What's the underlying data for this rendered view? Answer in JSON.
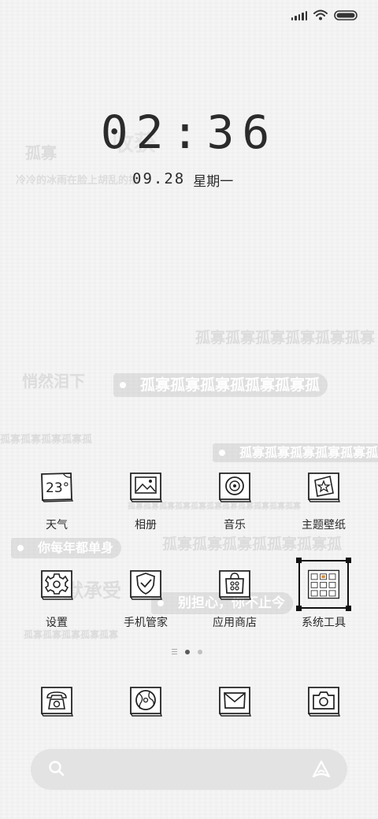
{
  "status_bar": {
    "signal_icon": "cellular-signal-icon",
    "wifi_icon": "wifi-icon",
    "battery_icon": "battery-icon"
  },
  "clock": {
    "time": "02:36",
    "date": "09.28",
    "weekday": "星期一"
  },
  "wallpaper_text": {
    "t1": "孤寡",
    "t2": "收获",
    "t3": "冷冷的冰雨在脸上胡乱的拍",
    "t4": "孤寡孤寡孤寡孤寡孤寡孤寡",
    "t5": "悄然泪下",
    "t6": "孤寡孤寡孤寡孤孤寡孤寡孤",
    "t7": "孤寡孤寡孤寡孤寡孤",
    "t8": "孤寡孤寡孤寡孤寡孤寡孤",
    "t9": "孤寡孤寡孤寡孤寡孤寡孤寡孤寡孤寡孤寡孤寡孤寡",
    "t10": "孤寡孤寡孤寡孤孤寡孤寡孤",
    "t11": "你每年都单身",
    "t12": "默承受",
    "t13": "别担心，你不止今",
    "t14": "孤寡孤寡孤寡孤寡孤寡"
  },
  "apps": [
    {
      "label": "天气",
      "icon": "weather-icon",
      "badge": "23°"
    },
    {
      "label": "相册",
      "icon": "gallery-icon"
    },
    {
      "label": "音乐",
      "icon": "music-icon"
    },
    {
      "label": "主题壁纸",
      "icon": "theme-wallpaper-icon"
    },
    {
      "label": "设置",
      "icon": "settings-gear-icon"
    },
    {
      "label": "手机管家",
      "icon": "security-shield-icon"
    },
    {
      "label": "应用商店",
      "icon": "app-store-bag-icon"
    },
    {
      "label": "系统工具",
      "icon": "system-tools-folder-icon"
    }
  ],
  "dock": [
    {
      "icon": "phone-icon"
    },
    {
      "icon": "browser-icon"
    },
    {
      "icon": "messages-icon"
    },
    {
      "icon": "camera-icon"
    }
  ],
  "pager": {
    "pages": 2,
    "current": 1
  },
  "search": {
    "placeholder": "",
    "search_icon": "search-icon",
    "assistant_icon": "assistant-icon"
  }
}
